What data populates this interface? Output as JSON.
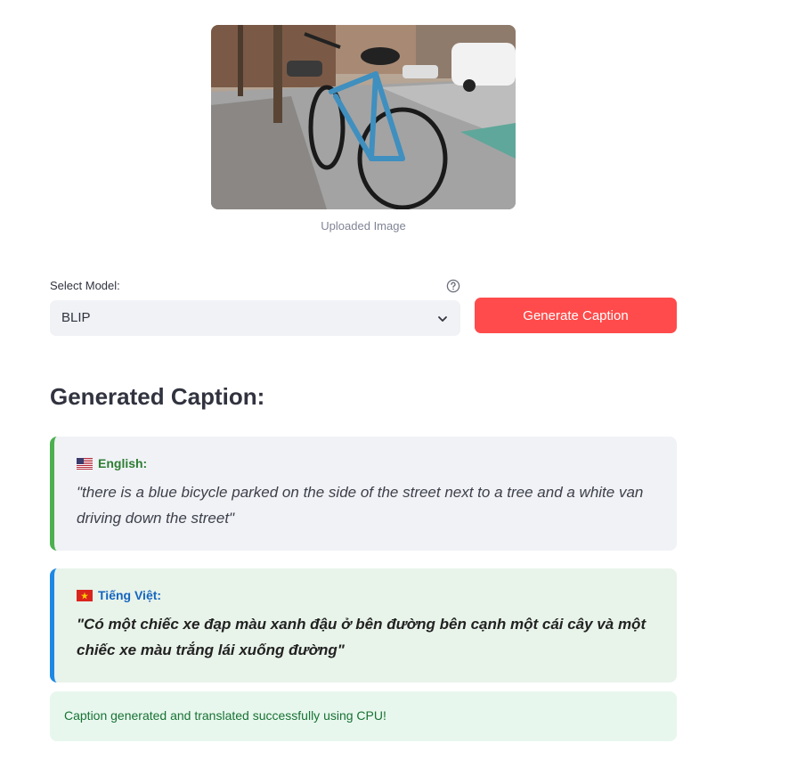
{
  "image": {
    "caption": "Uploaded Image",
    "alt": "uploaded-photo"
  },
  "model_select": {
    "label": "Select Model:",
    "value": "BLIP",
    "help_icon": "question-circle-icon",
    "chevron_icon": "chevron-down-icon"
  },
  "generate_button": {
    "label": "Generate Caption",
    "color": "#ff4b4b"
  },
  "result": {
    "title": "Generated Caption:",
    "english": {
      "flag": "us-flag-icon",
      "label": "English:",
      "text": "\"there is a blue bicycle parked on the side of the street next to a tree and a white van driving down the street\"",
      "accent": "#4caf50"
    },
    "vietnamese": {
      "flag": "vn-flag-icon",
      "label": "Tiếng Việt:",
      "text": "\"Có một chiếc xe đạp màu xanh đậu ở bên đường bên cạnh một cái cây và một chiếc xe màu trắng lái xuống đường\"",
      "accent": "#1e88e5"
    }
  },
  "status": {
    "message": "Caption generated and translated successfully using CPU!"
  }
}
